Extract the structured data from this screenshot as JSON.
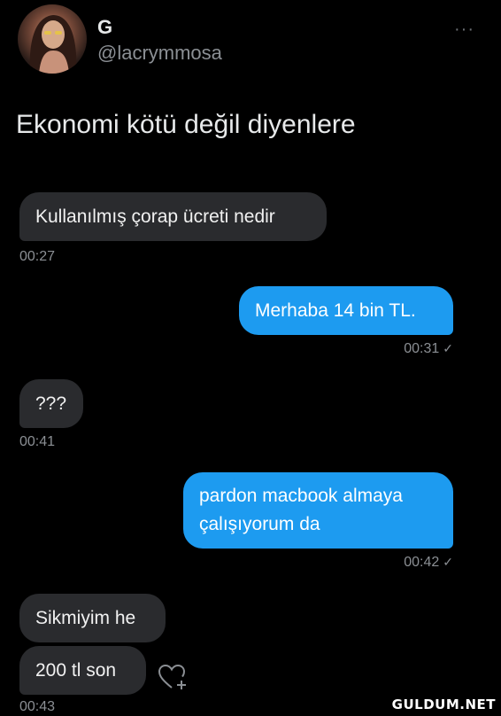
{
  "profile": {
    "display_name": "G",
    "handle": "@lacrymmosa",
    "more_label": "···"
  },
  "tweet": {
    "text": "Ekonomi kötü değil diyenlere"
  },
  "messages": [
    {
      "side": "received",
      "text": "Kullanılmış çorap ücreti nedir",
      "time": "00:27"
    },
    {
      "side": "sent",
      "text": "Merhaba 14 bin TL.",
      "time": "00:31"
    },
    {
      "side": "received",
      "text": "???",
      "time": "00:41"
    },
    {
      "side": "sent",
      "text": "pardon macbook almaya çalışıyorum da",
      "time": "00:42"
    },
    {
      "side": "received",
      "text": "Sikmiyim he",
      "time": ""
    },
    {
      "side": "received",
      "text": "200 tl son",
      "time": "00:43"
    }
  ],
  "icons": {
    "read_check": "✓",
    "react": "heart-plus-icon"
  },
  "colors": {
    "background": "#000000",
    "sent_bubble": "#1d9bf0",
    "received_bubble": "#2a2b2e",
    "timestamp": "#8b8f94"
  },
  "watermark": "GULDUM.NET"
}
